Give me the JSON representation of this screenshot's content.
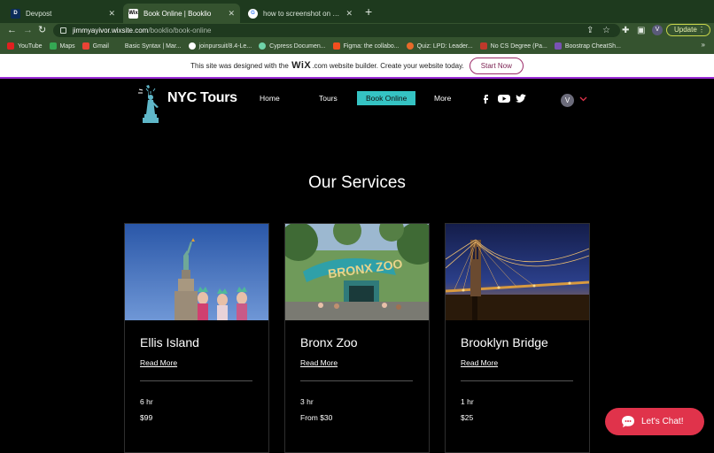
{
  "browser": {
    "tabs": [
      {
        "title": "Devpost",
        "favicon": "D",
        "active": false
      },
      {
        "title": "Book Online | Booklio",
        "favicon": "Wix",
        "active": true
      },
      {
        "title": "how to screenshot on mac - Go",
        "favicon": "G",
        "active": false
      }
    ],
    "url_domain": "jimmyayivor.wixsite.com",
    "url_path": "/booklio/book-online",
    "profile_initial": "V",
    "update_label": "Update",
    "bookmarks": [
      {
        "label": "YouTube",
        "color": "#e02020"
      },
      {
        "label": "Maps",
        "color": "#34a853"
      },
      {
        "label": "Gmail",
        "color": "#ea4335"
      },
      {
        "label": "Basic Syntax | Mar...",
        "color": "#35532f"
      },
      {
        "label": "joinpursuit/8.4-Le...",
        "color": "#ffffff"
      },
      {
        "label": "Cypress Documen...",
        "color": "#6fd3a8"
      },
      {
        "label": "Figma: the collabo...",
        "color": "#f24e1e"
      },
      {
        "label": "Quiz: LPD: Leader...",
        "color": "#e86a2a"
      },
      {
        "label": "No CS Degree (Pa...",
        "color": "#c0392b"
      },
      {
        "label": "Boostrap CheatSh...",
        "color": "#7952b3"
      }
    ]
  },
  "wix_banner": {
    "text_before": "This site was designed with the",
    "wix": "WiX",
    "text_after": ".com website builder. Create your website today.",
    "cta": "Start Now"
  },
  "site": {
    "brand": "NYC Tours",
    "nav": [
      "Home",
      "Tours",
      "Book Online",
      "More"
    ],
    "active_nav": "Book Online",
    "user_initial": "V",
    "accent": "#35c3c3"
  },
  "main": {
    "title": "Our Services",
    "services": [
      {
        "name": "Ellis Island",
        "link": "Read More",
        "duration": "6 hr",
        "price": "$99"
      },
      {
        "name": "Bronx Zoo",
        "link": "Read More",
        "duration": "3 hr",
        "price": "From $30"
      },
      {
        "name": "Brooklyn Bridge",
        "link": "Read More",
        "duration": "1 hr",
        "price": "$25"
      }
    ],
    "chat_label": "Let's Chat!",
    "chat_color": "#e0334b"
  }
}
